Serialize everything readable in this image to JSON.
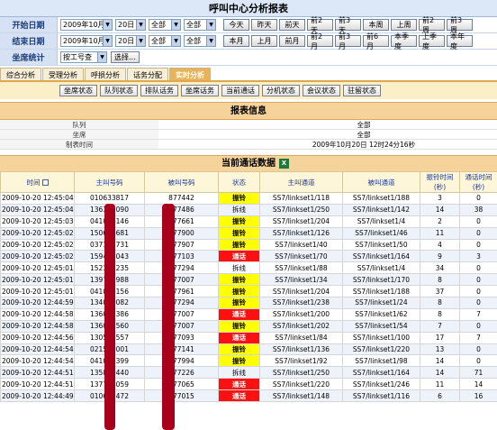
{
  "title": "呼叫中心分析报表",
  "filters": {
    "start_label": "开始日期",
    "end_label": "结束日期",
    "agent_label": "坐席统计",
    "start_month": "2009年10月",
    "start_day": "20日",
    "start_sel1": "全部",
    "start_sel2": "全部",
    "end_month": "2009年10月",
    "end_day": "20日",
    "end_sel1": "全部",
    "end_sel2": "全部",
    "agent_mode": "按工号查",
    "choose_btn": "选择...",
    "quick_row1": [
      "今天",
      "昨天",
      "前天",
      "前2天",
      "前3天",
      "本周",
      "上周",
      "前2周",
      "前3周"
    ],
    "quick_row2": [
      "本月",
      "上月",
      "前月",
      "前2月",
      "前3月",
      "前6月",
      "本季度",
      "上季度",
      "本年度"
    ]
  },
  "tabs": [
    {
      "label": "综合分析",
      "active": false
    },
    {
      "label": "受理分析",
      "active": false
    },
    {
      "label": "呼损分析",
      "active": false
    },
    {
      "label": "话务分配",
      "active": false
    },
    {
      "label": "实时分析",
      "active": true
    }
  ],
  "subtabs": [
    "坐席状态",
    "队列状态",
    "排队话务",
    "坐席话务",
    "当前通话",
    "分机状态",
    "会议状态",
    "驻留状态"
  ],
  "report_info": {
    "heading": "报表信息",
    "rows": [
      {
        "k": "队列",
        "v": "全部"
      },
      {
        "k": "坐席",
        "v": "全部"
      },
      {
        "k": "制表时间",
        "v": "2009年10月20日 12时24分16秒"
      }
    ]
  },
  "calls": {
    "heading": "当前通话数据",
    "columns": [
      "时间",
      "主叫号码",
      "被叫号码",
      "状态",
      "主叫通道",
      "被叫通道",
      "振铃时间 (秒)",
      "通话时间(秒)"
    ],
    "status_ring": "振铃",
    "status_talk": "通话",
    "rows": [
      [
        "2009-10-20 12:45:04",
        "010633817",
        "877442",
        "振铃",
        "SS7/linkset1/118",
        "SS7/linkset1/188",
        "3",
        "0"
      ],
      [
        "2009-10-20 12:45:04",
        "136375090",
        "877486",
        "拆线",
        "SS7/linkset1/250",
        "SS7/linkset1/142",
        "14",
        "38"
      ],
      [
        "2009-10-20 12:45:03",
        "041026146",
        "877661",
        "振铃",
        "SS7/linkset1/204",
        "SS7/linkset1/4",
        "2",
        "0"
      ],
      [
        "2009-10-20 12:45:02",
        "150678681",
        "877900",
        "振铃",
        "SS7/linkset1/126",
        "SS7/linkset1/46",
        "11",
        "0"
      ],
      [
        "2009-10-20 12:45:02",
        "037168731",
        "877907",
        "振铃",
        "SS7/linkset1/40",
        "SS7/linkset1/50",
        "4",
        "0"
      ],
      [
        "2009-10-20 12:45:02",
        "159478043",
        "877103",
        "通话",
        "SS7/linkset1/70",
        "SS7/linkset1/164",
        "9",
        "3"
      ],
      [
        "2009-10-20 12:45:01",
        "152355235",
        "877294",
        "拆线",
        "SS7/linkset1/88",
        "SS7/linkset1/4",
        "34",
        "0"
      ],
      [
        "2009-10-20 12:45:01",
        "139738988",
        "877007",
        "振铃",
        "SS7/linkset1/34",
        "SS7/linkset1/170",
        "8",
        "0"
      ],
      [
        "2009-10-20 12:45:01",
        "041026156",
        "877961",
        "振铃",
        "SS7/linkset1/204",
        "SS7/linkset1/188",
        "37",
        "0"
      ],
      [
        "2009-10-20 12:44:59",
        "134010082",
        "877294",
        "振铃",
        "SS7/linkset1/238",
        "SS7/linkset1/24",
        "8",
        "0"
      ],
      [
        "2009-10-20 12:44:58",
        "136032386",
        "877007",
        "通话",
        "SS7/linkset1/200",
        "SS7/linkset1/62",
        "8",
        "7"
      ],
      [
        "2009-10-20 12:44:58",
        "136061560",
        "877007",
        "振铃",
        "SS7/linkset1/202",
        "SS7/linkset1/54",
        "7",
        "0"
      ],
      [
        "2009-10-20 12:44:56",
        "130516557",
        "877093",
        "通话",
        "SS7/linkset1/84",
        "SS7/linkset1/100",
        "17",
        "7"
      ],
      [
        "2009-10-20 12:44:54",
        "021590001",
        "877141",
        "振铃",
        "SS7/linkset1/136",
        "SS7/linkset1/220",
        "13",
        "0"
      ],
      [
        "2009-10-20 12:44:54",
        "041046399",
        "877994",
        "振铃",
        "SS7/linkset1/92",
        "SS7/linkset1/98",
        "14",
        "0"
      ],
      [
        "2009-10-20 12:44:51",
        "135820440",
        "877226",
        "拆线",
        "SS7/linkset1/250",
        "SS7/linkset1/164",
        "14",
        "71"
      ],
      [
        "2009-10-20 12:44:51",
        "137714059",
        "877065",
        "通话",
        "SS7/linkset1/220",
        "SS7/linkset1/246",
        "11",
        "14"
      ],
      [
        "2009-10-20 12:44:49",
        "010635472",
        "877015",
        "通话",
        "SS7/linkset1/148",
        "SS7/linkset1/116",
        "6",
        "16"
      ]
    ]
  },
  "colors": {
    "ring": "#ffff00",
    "talk": "#ff1010",
    "header": "#f6d39a",
    "tab_active": "#e8b35a",
    "redaction": "#a8001c"
  }
}
